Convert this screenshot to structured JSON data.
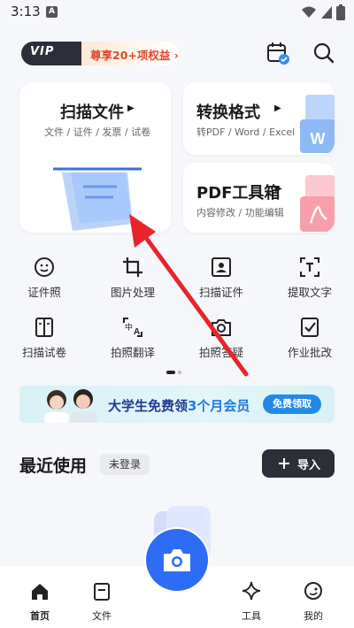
{
  "status_bar": {
    "time": "3:13",
    "app_icon": "A"
  },
  "header": {
    "vip_badge": "VIP",
    "vip_text": "尊享20+项权益 ›",
    "calendar_icon": "calendar-check-icon",
    "search_icon": "search-icon"
  },
  "cards": {
    "scan": {
      "title": "扫描文件",
      "subtitle": "文件 / 证件 / 发票 / 试卷"
    },
    "convert": {
      "title": "转换格式",
      "subtitle": "转PDF / Word / Excel"
    },
    "pdf": {
      "title": "PDF工具箱",
      "subtitle": "内容修改 / 功能编辑"
    }
  },
  "tools": [
    {
      "label": "证件照",
      "icon": "id-photo-icon"
    },
    {
      "label": "图片处理",
      "icon": "crop-icon"
    },
    {
      "label": "扫描证件",
      "icon": "id-card-icon"
    },
    {
      "label": "提取文字",
      "icon": "text-extract-icon"
    },
    {
      "label": "扫描试卷",
      "icon": "exam-paper-icon"
    },
    {
      "label": "拍照翻译",
      "icon": "translate-icon"
    },
    {
      "label": "拍照答疑",
      "icon": "camera-question-icon"
    },
    {
      "label": "作业批改",
      "icon": "homework-check-icon"
    }
  ],
  "banner": {
    "text_prefix": "大学生免费领",
    "text_highlight": "3个月会员",
    "button": "免费领取"
  },
  "recent": {
    "title": "最近使用",
    "status": "未登录",
    "import_button": "导入"
  },
  "nav": {
    "home": "首页",
    "files": "文件",
    "tools": "工具",
    "mine": "我的"
  },
  "colors": {
    "accent": "#2d6df6",
    "dark": "#2c2f3a",
    "vip_text": "#e0472b",
    "arrow": "#e8242a"
  }
}
